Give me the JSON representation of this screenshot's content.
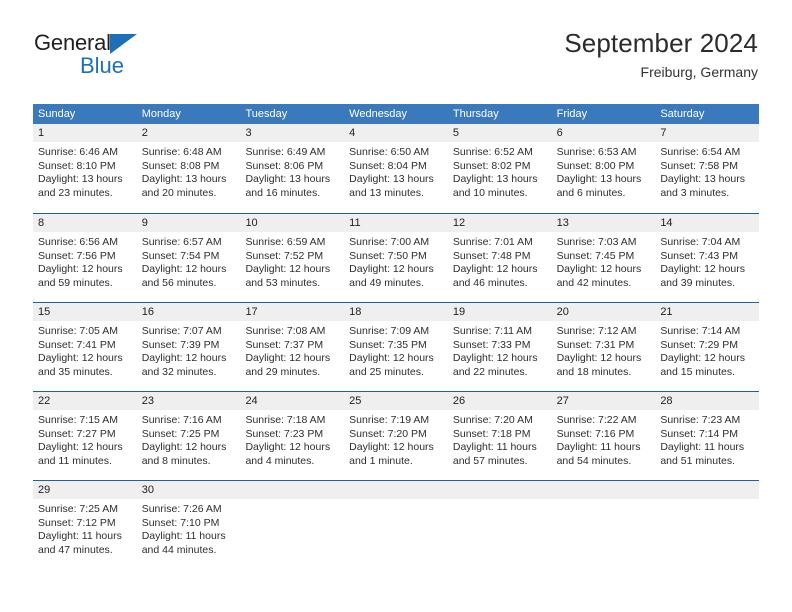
{
  "brand": {
    "name_part1": "General",
    "name_part2": "Blue",
    "triangle_icon": "blue-triangle-icon",
    "accent_color": "#1d70b8"
  },
  "header": {
    "title": "September 2024",
    "subtitle": "Freiburg, Germany"
  },
  "colors": {
    "weekday_header_bg": "#3b79bd",
    "week_separator": "#1f5fa8",
    "daynum_band_bg": "#efefef",
    "text": "#2e2e2e"
  },
  "weekdays": [
    "Sunday",
    "Monday",
    "Tuesday",
    "Wednesday",
    "Thursday",
    "Friday",
    "Saturday"
  ],
  "weeks": [
    [
      {
        "day": "1",
        "sunrise": "Sunrise: 6:46 AM",
        "sunset": "Sunset: 8:10 PM",
        "daylight1": "Daylight: 13 hours",
        "daylight2": "and 23 minutes."
      },
      {
        "day": "2",
        "sunrise": "Sunrise: 6:48 AM",
        "sunset": "Sunset: 8:08 PM",
        "daylight1": "Daylight: 13 hours",
        "daylight2": "and 20 minutes."
      },
      {
        "day": "3",
        "sunrise": "Sunrise: 6:49 AM",
        "sunset": "Sunset: 8:06 PM",
        "daylight1": "Daylight: 13 hours",
        "daylight2": "and 16 minutes."
      },
      {
        "day": "4",
        "sunrise": "Sunrise: 6:50 AM",
        "sunset": "Sunset: 8:04 PM",
        "daylight1": "Daylight: 13 hours",
        "daylight2": "and 13 minutes."
      },
      {
        "day": "5",
        "sunrise": "Sunrise: 6:52 AM",
        "sunset": "Sunset: 8:02 PM",
        "daylight1": "Daylight: 13 hours",
        "daylight2": "and 10 minutes."
      },
      {
        "day": "6",
        "sunrise": "Sunrise: 6:53 AM",
        "sunset": "Sunset: 8:00 PM",
        "daylight1": "Daylight: 13 hours",
        "daylight2": "and 6 minutes."
      },
      {
        "day": "7",
        "sunrise": "Sunrise: 6:54 AM",
        "sunset": "Sunset: 7:58 PM",
        "daylight1": "Daylight: 13 hours",
        "daylight2": "and 3 minutes."
      }
    ],
    [
      {
        "day": "8",
        "sunrise": "Sunrise: 6:56 AM",
        "sunset": "Sunset: 7:56 PM",
        "daylight1": "Daylight: 12 hours",
        "daylight2": "and 59 minutes."
      },
      {
        "day": "9",
        "sunrise": "Sunrise: 6:57 AM",
        "sunset": "Sunset: 7:54 PM",
        "daylight1": "Daylight: 12 hours",
        "daylight2": "and 56 minutes."
      },
      {
        "day": "10",
        "sunrise": "Sunrise: 6:59 AM",
        "sunset": "Sunset: 7:52 PM",
        "daylight1": "Daylight: 12 hours",
        "daylight2": "and 53 minutes."
      },
      {
        "day": "11",
        "sunrise": "Sunrise: 7:00 AM",
        "sunset": "Sunset: 7:50 PM",
        "daylight1": "Daylight: 12 hours",
        "daylight2": "and 49 minutes."
      },
      {
        "day": "12",
        "sunrise": "Sunrise: 7:01 AM",
        "sunset": "Sunset: 7:48 PM",
        "daylight1": "Daylight: 12 hours",
        "daylight2": "and 46 minutes."
      },
      {
        "day": "13",
        "sunrise": "Sunrise: 7:03 AM",
        "sunset": "Sunset: 7:45 PM",
        "daylight1": "Daylight: 12 hours",
        "daylight2": "and 42 minutes."
      },
      {
        "day": "14",
        "sunrise": "Sunrise: 7:04 AM",
        "sunset": "Sunset: 7:43 PM",
        "daylight1": "Daylight: 12 hours",
        "daylight2": "and 39 minutes."
      }
    ],
    [
      {
        "day": "15",
        "sunrise": "Sunrise: 7:05 AM",
        "sunset": "Sunset: 7:41 PM",
        "daylight1": "Daylight: 12 hours",
        "daylight2": "and 35 minutes."
      },
      {
        "day": "16",
        "sunrise": "Sunrise: 7:07 AM",
        "sunset": "Sunset: 7:39 PM",
        "daylight1": "Daylight: 12 hours",
        "daylight2": "and 32 minutes."
      },
      {
        "day": "17",
        "sunrise": "Sunrise: 7:08 AM",
        "sunset": "Sunset: 7:37 PM",
        "daylight1": "Daylight: 12 hours",
        "daylight2": "and 29 minutes."
      },
      {
        "day": "18",
        "sunrise": "Sunrise: 7:09 AM",
        "sunset": "Sunset: 7:35 PM",
        "daylight1": "Daylight: 12 hours",
        "daylight2": "and 25 minutes."
      },
      {
        "day": "19",
        "sunrise": "Sunrise: 7:11 AM",
        "sunset": "Sunset: 7:33 PM",
        "daylight1": "Daylight: 12 hours",
        "daylight2": "and 22 minutes."
      },
      {
        "day": "20",
        "sunrise": "Sunrise: 7:12 AM",
        "sunset": "Sunset: 7:31 PM",
        "daylight1": "Daylight: 12 hours",
        "daylight2": "and 18 minutes."
      },
      {
        "day": "21",
        "sunrise": "Sunrise: 7:14 AM",
        "sunset": "Sunset: 7:29 PM",
        "daylight1": "Daylight: 12 hours",
        "daylight2": "and 15 minutes."
      }
    ],
    [
      {
        "day": "22",
        "sunrise": "Sunrise: 7:15 AM",
        "sunset": "Sunset: 7:27 PM",
        "daylight1": "Daylight: 12 hours",
        "daylight2": "and 11 minutes."
      },
      {
        "day": "23",
        "sunrise": "Sunrise: 7:16 AM",
        "sunset": "Sunset: 7:25 PM",
        "daylight1": "Daylight: 12 hours",
        "daylight2": "and 8 minutes."
      },
      {
        "day": "24",
        "sunrise": "Sunrise: 7:18 AM",
        "sunset": "Sunset: 7:23 PM",
        "daylight1": "Daylight: 12 hours",
        "daylight2": "and 4 minutes."
      },
      {
        "day": "25",
        "sunrise": "Sunrise: 7:19 AM",
        "sunset": "Sunset: 7:20 PM",
        "daylight1": "Daylight: 12 hours",
        "daylight2": "and 1 minute."
      },
      {
        "day": "26",
        "sunrise": "Sunrise: 7:20 AM",
        "sunset": "Sunset: 7:18 PM",
        "daylight1": "Daylight: 11 hours",
        "daylight2": "and 57 minutes."
      },
      {
        "day": "27",
        "sunrise": "Sunrise: 7:22 AM",
        "sunset": "Sunset: 7:16 PM",
        "daylight1": "Daylight: 11 hours",
        "daylight2": "and 54 minutes."
      },
      {
        "day": "28",
        "sunrise": "Sunrise: 7:23 AM",
        "sunset": "Sunset: 7:14 PM",
        "daylight1": "Daylight: 11 hours",
        "daylight2": "and 51 minutes."
      }
    ],
    [
      {
        "day": "29",
        "sunrise": "Sunrise: 7:25 AM",
        "sunset": "Sunset: 7:12 PM",
        "daylight1": "Daylight: 11 hours",
        "daylight2": "and 47 minutes."
      },
      {
        "day": "30",
        "sunrise": "Sunrise: 7:26 AM",
        "sunset": "Sunset: 7:10 PM",
        "daylight1": "Daylight: 11 hours",
        "daylight2": "and 44 minutes."
      },
      {
        "day": "",
        "sunrise": "",
        "sunset": "",
        "daylight1": "",
        "daylight2": ""
      },
      {
        "day": "",
        "sunrise": "",
        "sunset": "",
        "daylight1": "",
        "daylight2": ""
      },
      {
        "day": "",
        "sunrise": "",
        "sunset": "",
        "daylight1": "",
        "daylight2": ""
      },
      {
        "day": "",
        "sunrise": "",
        "sunset": "",
        "daylight1": "",
        "daylight2": ""
      },
      {
        "day": "",
        "sunrise": "",
        "sunset": "",
        "daylight1": "",
        "daylight2": ""
      }
    ]
  ]
}
